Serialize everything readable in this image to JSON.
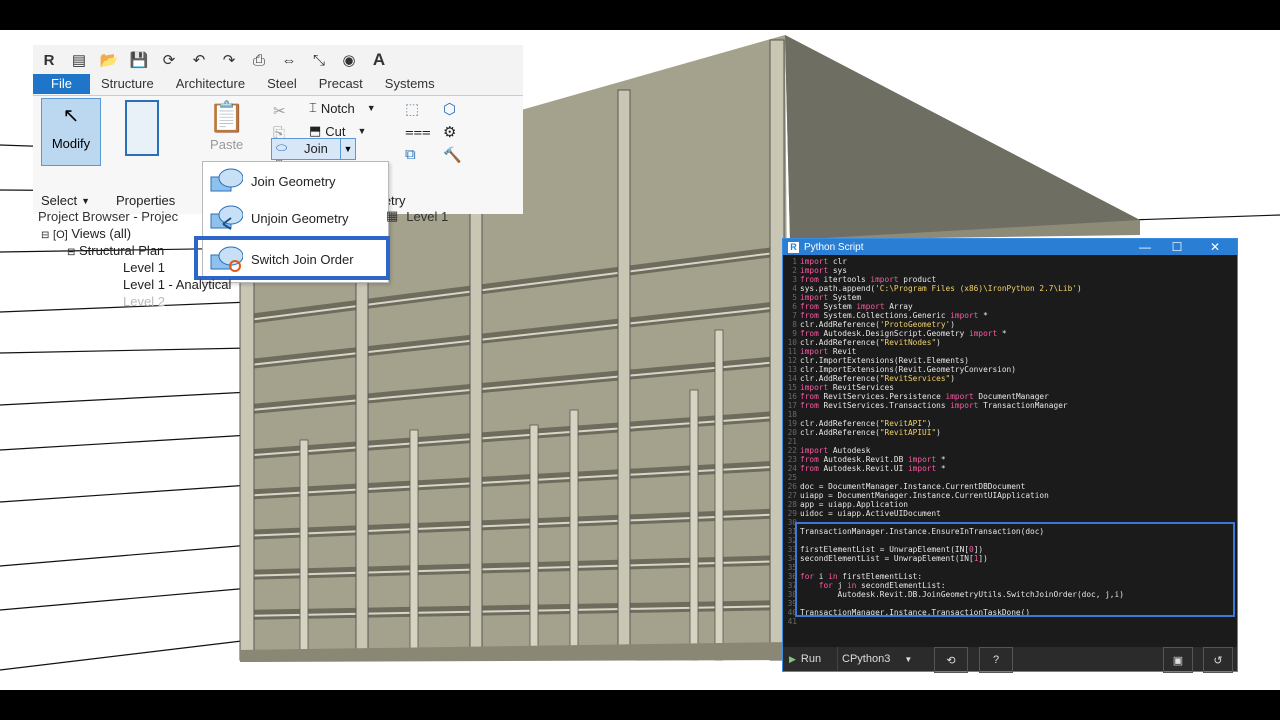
{
  "ribbon": {
    "tabs": [
      "File",
      "Structure",
      "Architecture",
      "Steel",
      "Precast",
      "Systems"
    ],
    "modify_label": "Modify",
    "select_label": "Select",
    "properties_label": "Properties",
    "paste_label": "Paste",
    "notch_label": "Notch",
    "cut_label": "Cut",
    "join_label": "Join",
    "geometry_label": "metry",
    "icons": [
      "revit-logo",
      "open-icon",
      "save-icon",
      "sync-icon",
      "undo-icon",
      "redo-icon",
      "print-icon",
      "measure-icon",
      "dimension-icon",
      "tag-icon",
      "text-icon"
    ]
  },
  "dropdown": {
    "items": [
      "Join Geometry",
      "Unjoin Geometry",
      "Switch Join Order"
    ]
  },
  "project_browser": {
    "title": "Project Browser - Projec",
    "views": "Views (all)",
    "structural_plans": "Structural Plan",
    "levels": [
      "Level 1",
      "Level 1 - Analytical",
      "Level 2"
    ],
    "level_tab": "Level 1"
  },
  "python_window": {
    "title": "Python Script",
    "controls": [
      "—",
      "☐",
      "✕"
    ],
    "lines": [
      {
        "n": "1",
        "c": [
          {
            "t": "import",
            "k": 1
          },
          {
            "t": " clr"
          }
        ]
      },
      {
        "n": "2",
        "c": [
          {
            "t": "import",
            "k": 1
          },
          {
            "t": " sys"
          }
        ]
      },
      {
        "n": "3",
        "c": [
          {
            "t": "from",
            "k": 1
          },
          {
            "t": " itertools "
          },
          {
            "t": "import",
            "k": 1
          },
          {
            "t": " product"
          }
        ]
      },
      {
        "n": "4",
        "c": [
          {
            "t": "sys.path.append("
          },
          {
            "t": "'C:\\Program Files (x86)\\IronPython 2.7\\Lib'",
            "s": 1
          },
          {
            "t": ")"
          }
        ]
      },
      {
        "n": "5",
        "c": [
          {
            "t": "import",
            "k": 1
          },
          {
            "t": " System"
          }
        ]
      },
      {
        "n": "6",
        "c": [
          {
            "t": "from",
            "k": 1
          },
          {
            "t": " System "
          },
          {
            "t": "import",
            "k": 1
          },
          {
            "t": " Array"
          }
        ]
      },
      {
        "n": "7",
        "c": [
          {
            "t": "from",
            "k": 1
          },
          {
            "t": " System.Collections.Generic "
          },
          {
            "t": "import",
            "k": 1
          },
          {
            "t": " *"
          }
        ]
      },
      {
        "n": "8",
        "c": [
          {
            "t": "clr.AddReference("
          },
          {
            "t": "'ProtoGeometry'",
            "s": 1
          },
          {
            "t": ")"
          }
        ]
      },
      {
        "n": "9",
        "c": [
          {
            "t": "from",
            "k": 1
          },
          {
            "t": " Autodesk.DesignScript.Geometry "
          },
          {
            "t": "import",
            "k": 1
          },
          {
            "t": " *"
          }
        ]
      },
      {
        "n": "10",
        "c": [
          {
            "t": "clr.AddReference("
          },
          {
            "t": "\"RevitNodes\"",
            "s": 1
          },
          {
            "t": ")"
          }
        ]
      },
      {
        "n": "11",
        "c": [
          {
            "t": "import",
            "k": 1
          },
          {
            "t": " Revit"
          }
        ]
      },
      {
        "n": "12",
        "c": [
          {
            "t": "clr.ImportExtensions(Revit.Elements)"
          }
        ]
      },
      {
        "n": "13",
        "c": [
          {
            "t": "clr.ImportExtensions(Revit.GeometryConversion)"
          }
        ]
      },
      {
        "n": "14",
        "c": [
          {
            "t": "clr.AddReference("
          },
          {
            "t": "\"RevitServices\"",
            "s": 1
          },
          {
            "t": ")"
          }
        ]
      },
      {
        "n": "15",
        "c": [
          {
            "t": "import",
            "k": 1
          },
          {
            "t": " RevitServices"
          }
        ]
      },
      {
        "n": "16",
        "c": [
          {
            "t": "from",
            "k": 1
          },
          {
            "t": " RevitServices.Persistence "
          },
          {
            "t": "import",
            "k": 1
          },
          {
            "t": " DocumentManager"
          }
        ]
      },
      {
        "n": "17",
        "c": [
          {
            "t": "from",
            "k": 1
          },
          {
            "t": " RevitServices.Transactions "
          },
          {
            "t": "import",
            "k": 1
          },
          {
            "t": " TransactionManager"
          }
        ]
      },
      {
        "n": "18",
        "c": []
      },
      {
        "n": "19",
        "c": [
          {
            "t": "clr.AddReference("
          },
          {
            "t": "\"RevitAPI\"",
            "s": 1
          },
          {
            "t": ")"
          }
        ]
      },
      {
        "n": "20",
        "c": [
          {
            "t": "clr.AddReference("
          },
          {
            "t": "\"RevitAPIUI\"",
            "s": 1
          },
          {
            "t": ")"
          }
        ]
      },
      {
        "n": "21",
        "c": []
      },
      {
        "n": "22",
        "c": [
          {
            "t": "import",
            "k": 1
          },
          {
            "t": " Autodesk"
          }
        ]
      },
      {
        "n": "23",
        "c": [
          {
            "t": "from",
            "k": 1
          },
          {
            "t": " Autodesk.Revit.DB "
          },
          {
            "t": "import",
            "k": 1
          },
          {
            "t": " *"
          }
        ]
      },
      {
        "n": "24",
        "c": [
          {
            "t": "from",
            "k": 1
          },
          {
            "t": " Autodesk.Revit.UI "
          },
          {
            "t": "import",
            "k": 1
          },
          {
            "t": " *"
          }
        ]
      },
      {
        "n": "25",
        "c": []
      },
      {
        "n": "26",
        "c": [
          {
            "t": "doc = DocumentManager.Instance.CurrentDBDocument"
          }
        ]
      },
      {
        "n": "27",
        "c": [
          {
            "t": "uiapp = DocumentManager.Instance.CurrentUIApplication"
          }
        ]
      },
      {
        "n": "28",
        "c": [
          {
            "t": "app = uiapp.Application"
          }
        ]
      },
      {
        "n": "29",
        "c": [
          {
            "t": "uidoc = uiapp.ActiveUIDocument"
          }
        ]
      },
      {
        "n": "30",
        "c": []
      },
      {
        "n": "31",
        "c": [
          {
            "t": "TransactionManager.Instance.EnsureInTransaction(doc)"
          }
        ]
      },
      {
        "n": "32",
        "c": []
      },
      {
        "n": "33",
        "c": [
          {
            "t": "firstElementList = UnwrapElement(IN["
          },
          {
            "t": "0",
            "k": 1
          },
          {
            "t": "])"
          }
        ]
      },
      {
        "n": "34",
        "c": [
          {
            "t": "secondElementList = UnwrapElement(IN["
          },
          {
            "t": "1",
            "k": 1
          },
          {
            "t": "])"
          }
        ]
      },
      {
        "n": "35",
        "c": []
      },
      {
        "n": "36",
        "c": [
          {
            "t": "for",
            "k": 1
          },
          {
            "t": " i "
          },
          {
            "t": "in",
            "k": 1
          },
          {
            "t": " firstElementList:"
          }
        ]
      },
      {
        "n": "37",
        "c": [
          {
            "t": "    "
          },
          {
            "t": "for",
            "k": 1
          },
          {
            "t": " j "
          },
          {
            "t": "in",
            "k": 1
          },
          {
            "t": " secondElementList:"
          }
        ]
      },
      {
        "n": "38",
        "c": [
          {
            "t": "        Autodesk.Revit.DB.JoinGeometryUtils.SwitchJoinOrder(doc, j,i)"
          }
        ]
      },
      {
        "n": "39",
        "c": []
      },
      {
        "n": "40",
        "c": [
          {
            "t": "TransactionManager.Instance.TransactionTaskDone()"
          }
        ]
      },
      {
        "n": "41",
        "c": []
      }
    ],
    "run_label": "Run",
    "engine_label": "CPython3",
    "colors": {
      "keyword": "#ff5aa8",
      "string": "#f2d36b",
      "accent": "#2a7fd4"
    }
  }
}
